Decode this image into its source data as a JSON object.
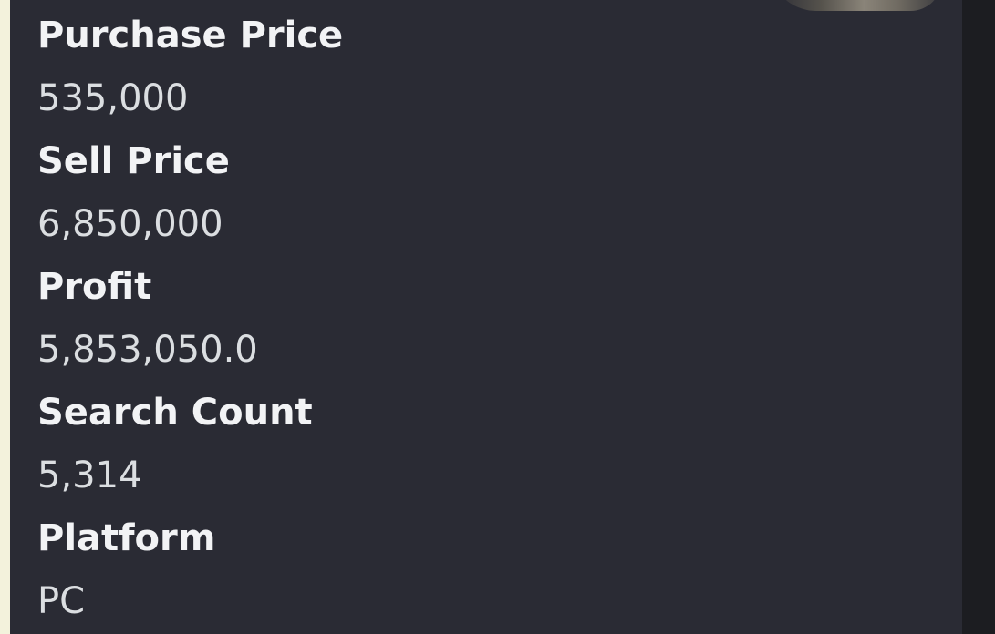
{
  "embed": {
    "accent_color": "#f3f2dc",
    "background_color": "#2a2b34",
    "fields": [
      {
        "name": "Purchase Price",
        "value": "535,000"
      },
      {
        "name": "Sell Price",
        "value": "6,850,000"
      },
      {
        "name": "Profit",
        "value": "5,853,050.0"
      },
      {
        "name": "Search Count",
        "value": "5,314"
      },
      {
        "name": "Platform",
        "value": "PC"
      }
    ]
  }
}
